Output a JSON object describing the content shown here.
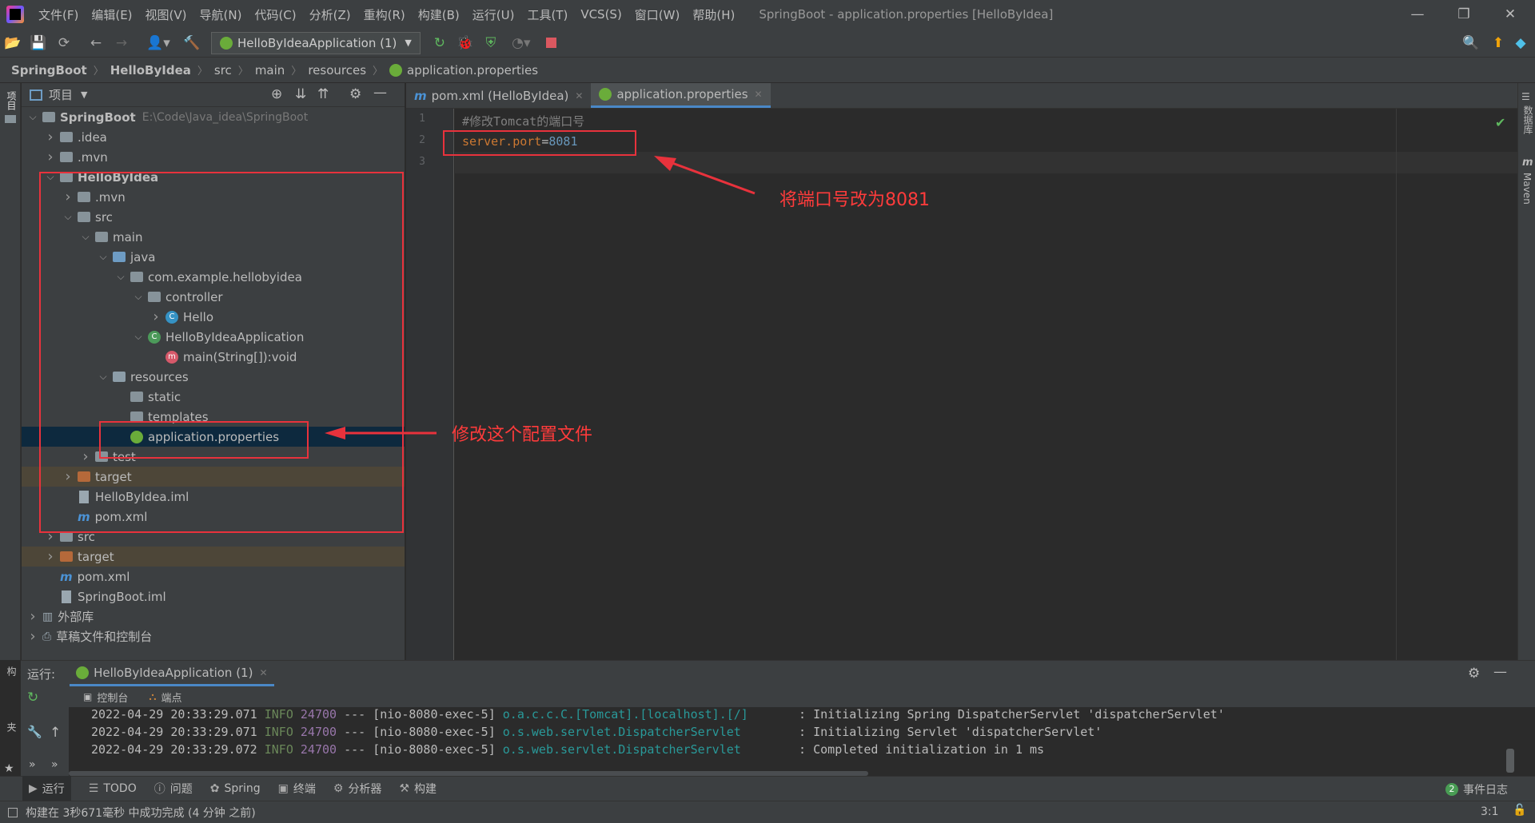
{
  "menubar": {
    "items": [
      "文件(F)",
      "编辑(E)",
      "视图(V)",
      "导航(N)",
      "代码(C)",
      "分析(Z)",
      "重构(R)",
      "构建(B)",
      "运行(U)",
      "工具(T)",
      "VCS(S)",
      "窗口(W)",
      "帮助(H)"
    ],
    "window_title": "SpringBoot - application.properties [HelloByIdea]"
  },
  "toolbar": {
    "run_config": "HelloByIdeaApplication (1)"
  },
  "breadcrumb": [
    "SpringBoot",
    "HelloByIdea",
    "src",
    "main",
    "resources",
    "application.properties"
  ],
  "project_panel": {
    "title": "项目",
    "side_label": "项目",
    "structure_label": "结构",
    "favorites_label": "收藏夹",
    "tree": [
      {
        "label": "SpringBoot",
        "path": "E:\\Code\\Java_idea\\SpringBoot",
        "bold": true
      },
      {
        "label": ".idea"
      },
      {
        "label": ".mvn"
      },
      {
        "label": "HelloByIdea",
        "bold": true
      },
      {
        "label": ".mvn"
      },
      {
        "label": "src"
      },
      {
        "label": "main"
      },
      {
        "label": "java"
      },
      {
        "label": "com.example.hellobyidea"
      },
      {
        "label": "controller"
      },
      {
        "label": "Hello"
      },
      {
        "label": "HelloByIdeaApplication"
      },
      {
        "label": "main(String[]):void"
      },
      {
        "label": "resources"
      },
      {
        "label": "static"
      },
      {
        "label": "templates"
      },
      {
        "label": "application.properties"
      },
      {
        "label": "test"
      },
      {
        "label": "target"
      },
      {
        "label": "HelloByIdea.iml"
      },
      {
        "label": "pom.xml"
      },
      {
        "label": "src"
      },
      {
        "label": "target"
      },
      {
        "label": "pom.xml"
      },
      {
        "label": "SpringBoot.iml"
      },
      {
        "label": "外部库"
      },
      {
        "label": "草稿文件和控制台"
      }
    ]
  },
  "editor": {
    "tabs": [
      {
        "label": "pom.xml (HelloByIdea)"
      },
      {
        "label": "application.properties"
      }
    ],
    "lines": [
      {
        "num": "1",
        "text": "#修改Tomcat的端口号"
      },
      {
        "num": "2",
        "key": "server.port",
        "eq": "=",
        "value": "8081"
      },
      {
        "num": "3",
        "text": ""
      }
    ]
  },
  "right_strip": {
    "database": "数据库",
    "maven": "Maven"
  },
  "annotations": {
    "port": "将端口号改为8081",
    "file": "修改这个配置文件"
  },
  "run_panel": {
    "label": "运行:",
    "tab": "HelloByIdeaApplication (1)",
    "sub_tabs": [
      "控制台",
      "端点"
    ],
    "logs": [
      {
        "time": "2022-04-29 20:33:29.071",
        "level": "INFO",
        "pid": "24700",
        "sep": "---",
        "thread": "[nio-8080-exec-5]",
        "logger": "o.a.c.c.C.[Tomcat].[localhost].[/]      ",
        "msg": ": Initializing Spring DispatcherServlet 'dispatcherServlet'"
      },
      {
        "time": "2022-04-29 20:33:29.071",
        "level": "INFO",
        "pid": "24700",
        "sep": "---",
        "thread": "[nio-8080-exec-5]",
        "logger": "o.s.web.servlet.DispatcherServlet       ",
        "msg": ": Initializing Servlet 'dispatcherServlet'"
      },
      {
        "time": "2022-04-29 20:33:29.072",
        "level": "INFO",
        "pid": "24700",
        "sep": "---",
        "thread": "[nio-8080-exec-5]",
        "logger": "o.s.web.servlet.DispatcherServlet       ",
        "msg": ": Completed initialization in 1 ms"
      }
    ]
  },
  "bottom_tabs": [
    "运行",
    "TODO",
    "问题",
    "Spring",
    "终端",
    "分析器",
    "构建"
  ],
  "event_log": {
    "count": "2",
    "label": "事件日志"
  },
  "status": {
    "text": "构建在 3秒671毫秒 中成功完成 (4 分钟 之前)",
    "position": "3:1"
  }
}
